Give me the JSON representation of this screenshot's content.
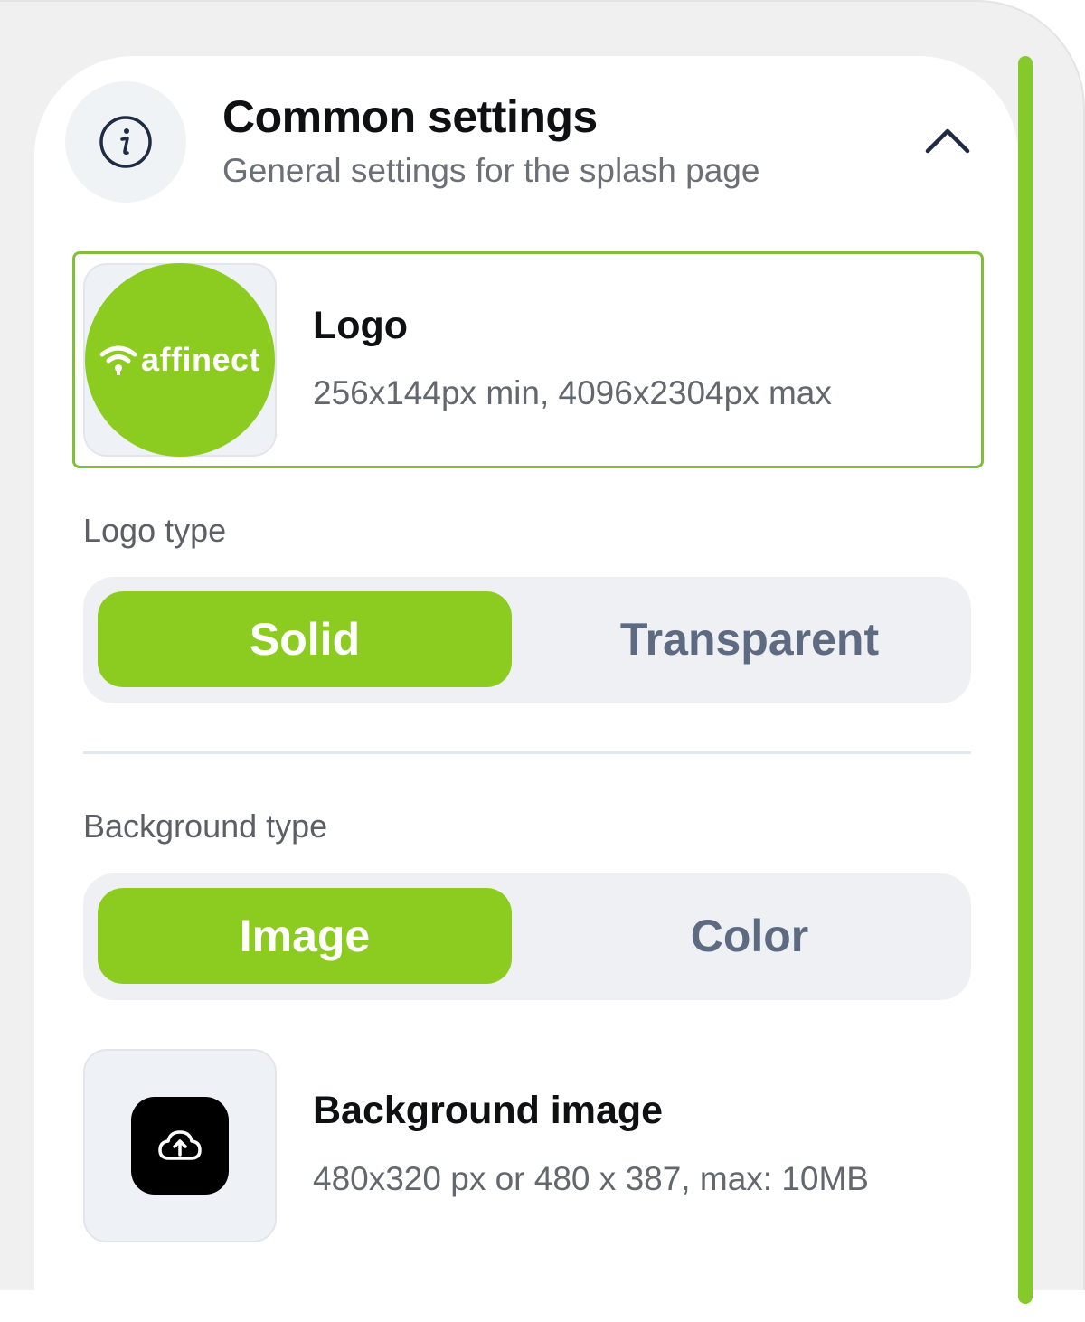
{
  "section": {
    "title": "Common settings",
    "subtitle": "General settings for the splash page",
    "info_icon": "info-icon",
    "toggle_icon": "chevron-up-icon"
  },
  "logo": {
    "heading": "Logo",
    "description": "256x144px min, 4096x2304px max",
    "brand_text": "affinect",
    "brand_icon": "wifi-icon",
    "brand_color": "#8ccc20"
  },
  "logo_type": {
    "label": "Logo type",
    "options": [
      "Solid",
      "Transparent"
    ],
    "selected": "Solid"
  },
  "background_type": {
    "label": "Background type",
    "options": [
      "Image",
      "Color"
    ],
    "selected": "Image"
  },
  "background_image": {
    "heading": "Background image",
    "description": "480x320 px or 480 x 387, max: 10MB",
    "upload_icon": "cloud-upload-icon"
  },
  "colors": {
    "accent": "#8ccc20",
    "scrollbar": "#86c92a",
    "selected_border": "#7fbf3a",
    "inactive_text": "#5d6a82"
  }
}
